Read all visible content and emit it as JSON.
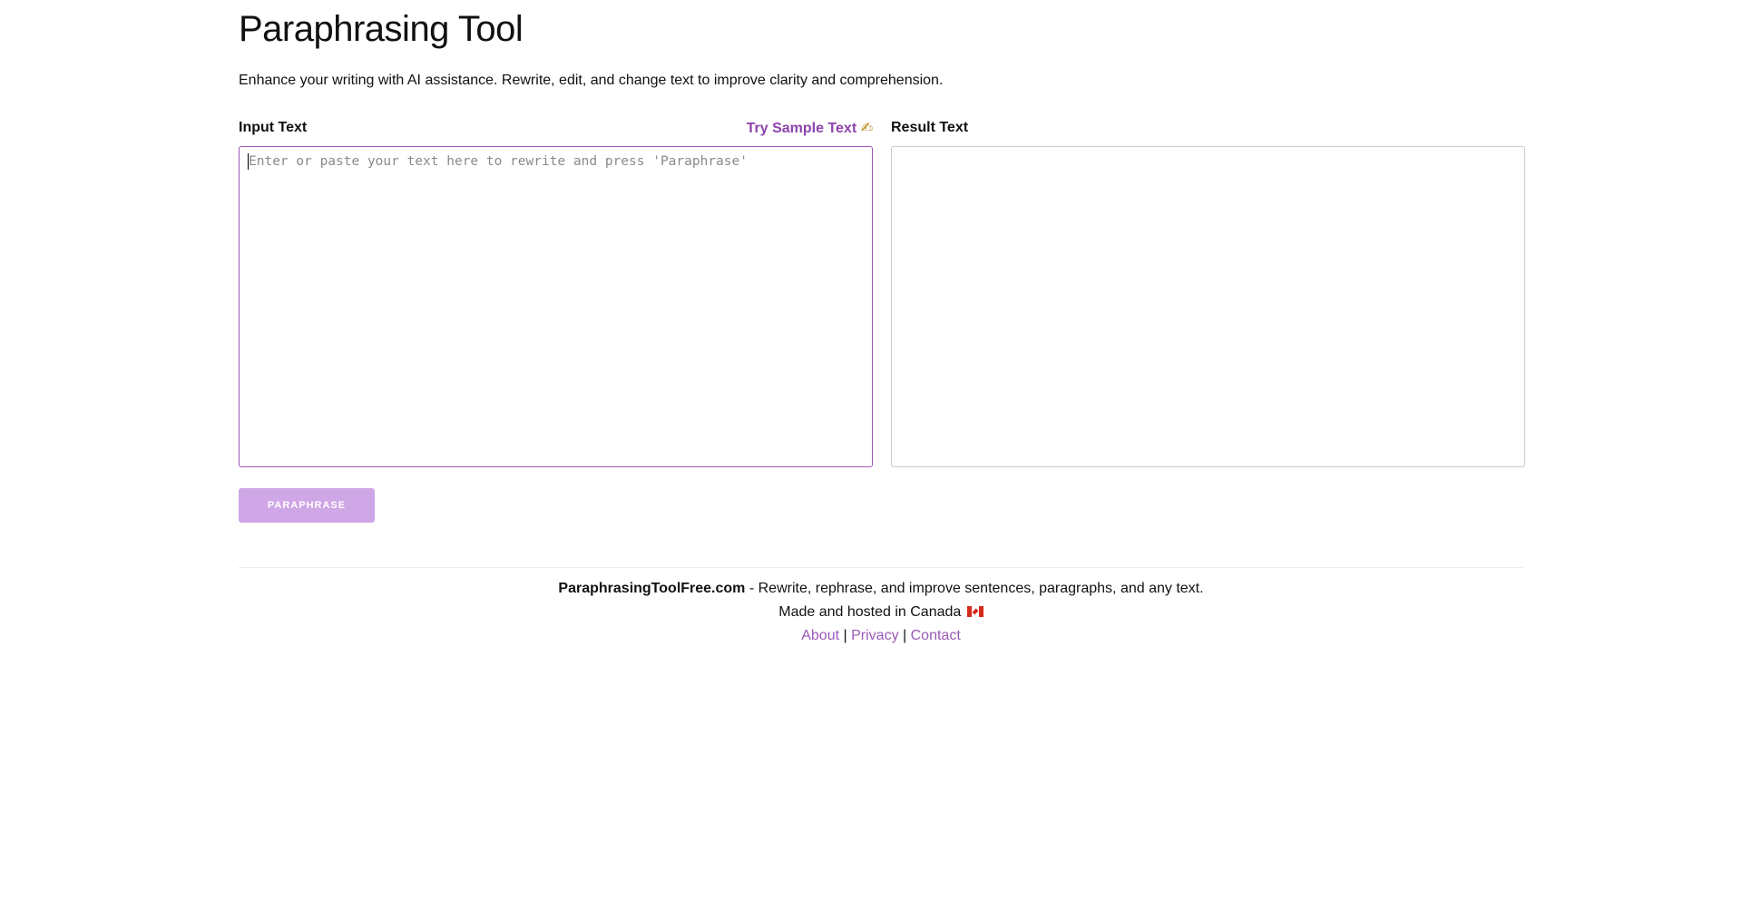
{
  "page": {
    "title": "Paraphrasing Tool",
    "subtitle": "Enhance your writing with AI assistance. Rewrite, edit, and change text to improve clarity and comprehension."
  },
  "input_panel": {
    "label": "Input Text",
    "sample_link": "Try Sample Text",
    "sample_icon": "writing-hand-icon",
    "sample_icon_glyph": "✍",
    "placeholder": "Enter or paste your text here to rewrite and press 'Paraphrase'",
    "value": ""
  },
  "result_panel": {
    "label": "Result Text",
    "value": ""
  },
  "actions": {
    "paraphrase_label": "PARAPHRASE"
  },
  "footer": {
    "brand": "ParaphrasingToolFree.com",
    "tagline": " - Rewrite, rephrase, and improve sentences, paragraphs, and any text.",
    "made_in": "Made and hosted in Canada",
    "flag_icon": "canada-flag-icon",
    "links": [
      "About",
      "Privacy",
      "Contact"
    ],
    "separator": "|"
  },
  "colors": {
    "accent": "#9b59b6",
    "button_disabled": "#cfa6e6",
    "text": "#111111"
  }
}
